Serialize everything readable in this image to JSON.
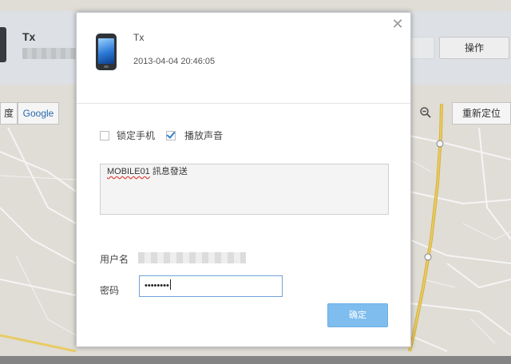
{
  "background": {
    "device_name": "Tx",
    "action_label": "操作",
    "map_left_label": "度",
    "map_provider_label": "Google",
    "zoom_icon": "magnifier-minus-icon",
    "relocate_label": "重新定位"
  },
  "dialog": {
    "close_icon": "close-icon",
    "device_icon": "phone-icon",
    "device_name": "Tx",
    "timestamp": "2013-04-04 20:46:05",
    "options": {
      "lock_label": "锁定手机",
      "lock_checked": false,
      "sound_label": "播放声音",
      "sound_checked": true
    },
    "message_word1": "MOBILE01",
    "message_word2": " 訊息發送",
    "username_label": "用户名",
    "password_label": "密码",
    "password_value": "••••••••",
    "confirm_label": "确定"
  },
  "colors": {
    "accent": "#7fbdee",
    "input_border": "#6fa3d8",
    "check": "#2f7fd1",
    "road": "#e0b93c"
  }
}
